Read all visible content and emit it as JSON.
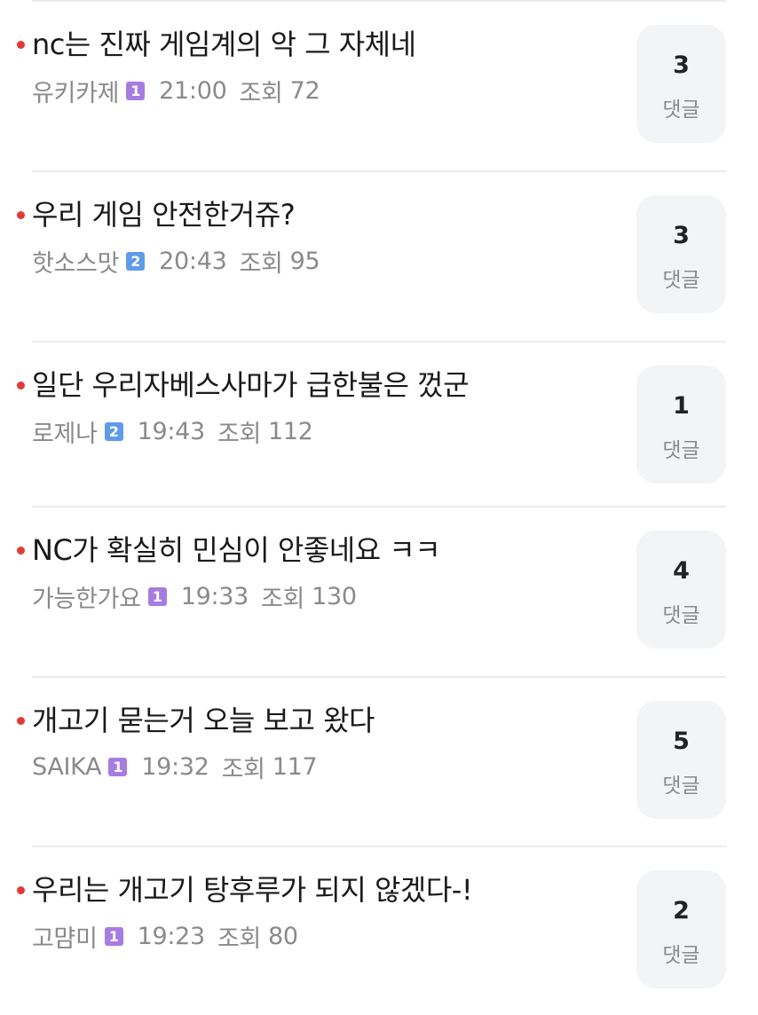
{
  "colors": {
    "new_dot": "#e53935",
    "level_1": "#a77ce0",
    "level_2": "#5f9be8",
    "comment_bg": "#f3f4f6",
    "meta_text": "#8a8a8a"
  },
  "posts": [
    {
      "title": "nc는 진짜 게임계의 악 그 자체네",
      "author": "유키카제",
      "level": "1",
      "time": "21:00",
      "views_label": "조회",
      "views": "72",
      "comments": "3",
      "comments_label": "댓글"
    },
    {
      "title": "우리 게임 안전한거쥬?",
      "author": "핫소스맛",
      "level": "2",
      "time": "20:43",
      "views_label": "조회",
      "views": "95",
      "comments": "3",
      "comments_label": "댓글"
    },
    {
      "title": "일단 우리자베스사마가 급한불은 껐군",
      "author": "로제나",
      "level": "2",
      "time": "19:43",
      "views_label": "조회",
      "views": "112",
      "comments": "1",
      "comments_label": "댓글"
    },
    {
      "title": "NC가 확실히 민심이 안좋네요 ㅋㅋ",
      "author": "가능한가요",
      "level": "1",
      "time": "19:33",
      "views_label": "조회",
      "views": "130",
      "comments": "4",
      "comments_label": "댓글"
    },
    {
      "title": "개고기 묻는거 오늘 보고 왔다",
      "author": "SAIKA",
      "level": "1",
      "time": "19:32",
      "views_label": "조회",
      "views": "117",
      "comments": "5",
      "comments_label": "댓글"
    },
    {
      "title": "우리는 개고기 탕후루가 되지 않겠다-!",
      "author": "고먐미",
      "level": "1",
      "time": "19:23",
      "views_label": "조회",
      "views": "80",
      "comments": "2",
      "comments_label": "댓글"
    }
  ]
}
